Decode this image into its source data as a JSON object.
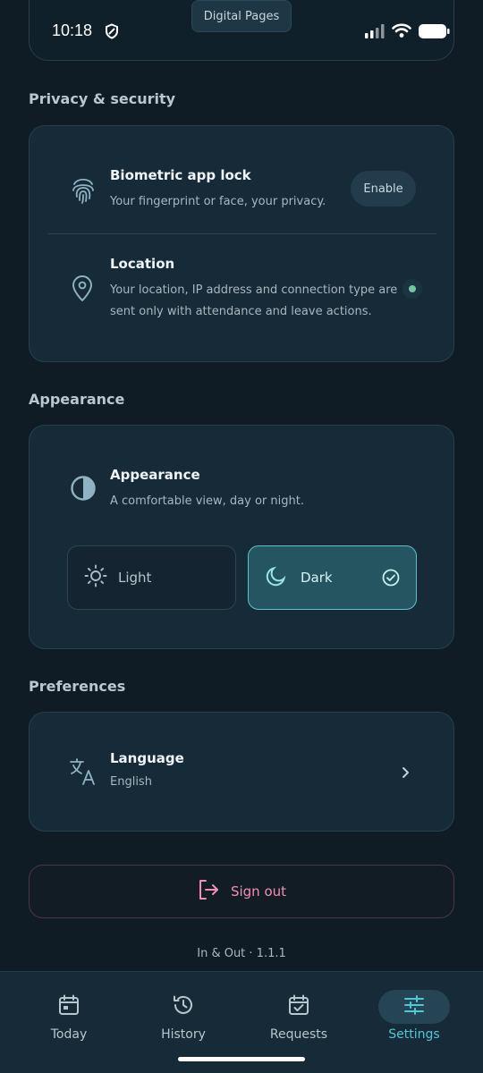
{
  "status_bar": {
    "time": "10:18",
    "notch_label": "Digital Pages"
  },
  "privacy": {
    "section_title": "Privacy & security",
    "biometric": {
      "title": "Biometric app lock",
      "subtitle": "Your fingerprint or face, your privacy.",
      "button_label": "Enable",
      "icon": "fingerprint-icon"
    },
    "location": {
      "title": "Location",
      "subtitle_line1": "Your location, IP address and connection type are",
      "subtitle_line2": "sent only with attendance and leave actions.",
      "icon": "location-pin-icon",
      "enabled": true
    }
  },
  "appearance": {
    "section_title": "Appearance",
    "title": "Appearance",
    "subtitle": "A comfortable view, day or night.",
    "options": [
      {
        "label": "Light",
        "icon": "sun-icon",
        "selected": false
      },
      {
        "label": "Dark",
        "icon": "moon-icon",
        "selected": true
      }
    ]
  },
  "preferences": {
    "section_title": "Preferences",
    "language": {
      "title": "Language",
      "value": "English",
      "icon": "translate-icon"
    }
  },
  "sign_out": {
    "label": "Sign out"
  },
  "version": "In & Out · 1.1.1",
  "nav": {
    "items": [
      {
        "label": "Today",
        "icon": "calendar-icon",
        "active": false
      },
      {
        "label": "History",
        "icon": "history-icon",
        "active": false
      },
      {
        "label": "Requests",
        "icon": "calendar-check-icon",
        "active": false
      },
      {
        "label": "Settings",
        "icon": "sliders-icon",
        "active": true
      }
    ]
  },
  "colors": {
    "background": "#0f1c25",
    "card": "#162a37",
    "accent": "#4fc9d6",
    "danger": "#f08fb3",
    "toggle_on": "#6fc99a"
  }
}
